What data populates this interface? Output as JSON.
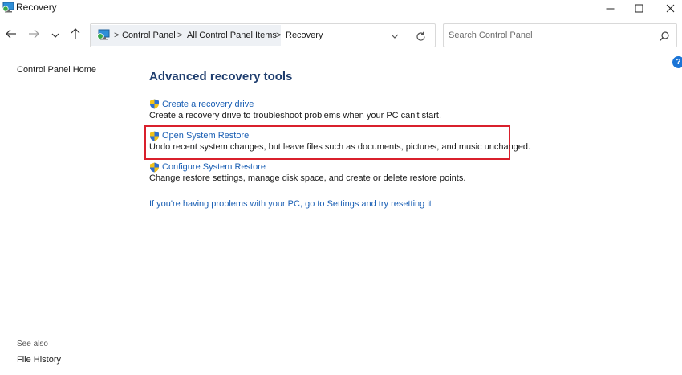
{
  "window": {
    "title": "Recovery",
    "controls": {
      "minimize_icon": "minimize-icon",
      "maximize_icon": "maximize-icon",
      "close_icon": "close-icon"
    }
  },
  "navigation": {
    "back_icon": "back-arrow-icon",
    "forward_icon": "forward-arrow-icon",
    "recent_icon": "chevron-down-icon",
    "up_icon": "up-arrow-icon"
  },
  "address_bar": {
    "breadcrumbs": [
      "Control Panel",
      "All Control Panel Items",
      "Recovery"
    ],
    "separator": ">",
    "dropdown_icon": "chevron-down-icon",
    "refresh_icon": "refresh-icon"
  },
  "search": {
    "placeholder": "Search Control Panel",
    "value": "",
    "icon": "search-icon"
  },
  "help": {
    "label": "?"
  },
  "left_pane": {
    "home_link": "Control Panel Home",
    "see_also_heading": "See also",
    "see_also_links": [
      "File History"
    ]
  },
  "main": {
    "title": "Advanced recovery tools",
    "tasks": [
      {
        "link": "Create a recovery drive",
        "description": "Create a recovery drive to troubleshoot problems when your PC can't start.",
        "icon": "shield-icon"
      },
      {
        "link": "Open System Restore",
        "description": "Undo recent system changes, but leave files such as documents, pictures, and music unchanged.",
        "icon": "shield-icon",
        "highlighted": true
      },
      {
        "link": "Configure System Restore",
        "description": "Change restore settings, manage disk space, and create or delete restore points.",
        "icon": "shield-icon"
      }
    ],
    "reset_link": "If you're having problems with your PC, go to Settings and try resetting it"
  },
  "colors": {
    "link": "#1a5fb4",
    "heading": "#1e3d6e",
    "highlight_border": "#d9202c",
    "breadcrumb_background": "#eef1f5"
  }
}
